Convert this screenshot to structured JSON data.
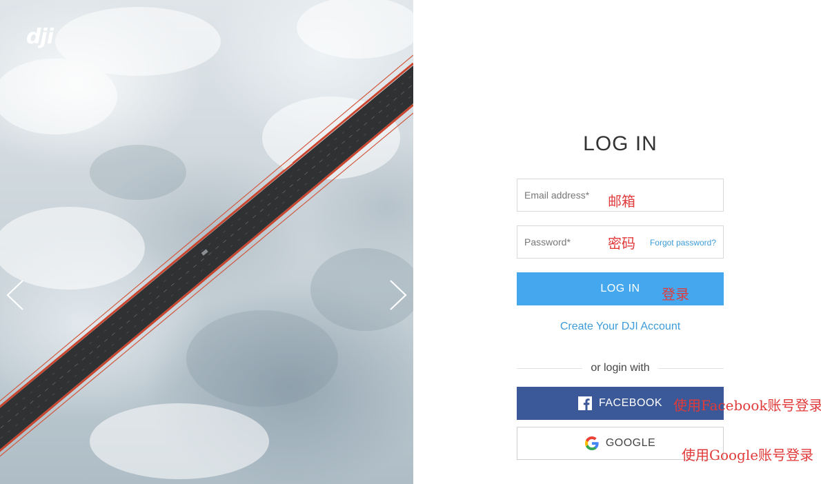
{
  "brand": {
    "logo_text": "dji"
  },
  "carousel": {
    "prev_icon": "chevron-left-icon",
    "next_icon": "chevron-right-icon"
  },
  "form": {
    "title": "LOG IN",
    "email": {
      "placeholder": "Email address*",
      "value": ""
    },
    "password": {
      "placeholder": "Password*",
      "value": ""
    },
    "forgot_label": "Forgot password?",
    "login_label": "LOG IN",
    "create_account_label": "Create Your DJI Account",
    "divider_label": "or login with",
    "facebook_label": "FACEBOOK",
    "google_label": "GOOGLE"
  },
  "annotations": {
    "email": "邮箱",
    "password": "密码",
    "login": "登录",
    "facebook": "使用Facebook账号登录",
    "google": "使用Google账号登录"
  },
  "colors": {
    "login_button": "#45a8ee",
    "facebook_button": "#3b5998",
    "link": "#3c9bd8",
    "annotation": "#e03a3a"
  }
}
